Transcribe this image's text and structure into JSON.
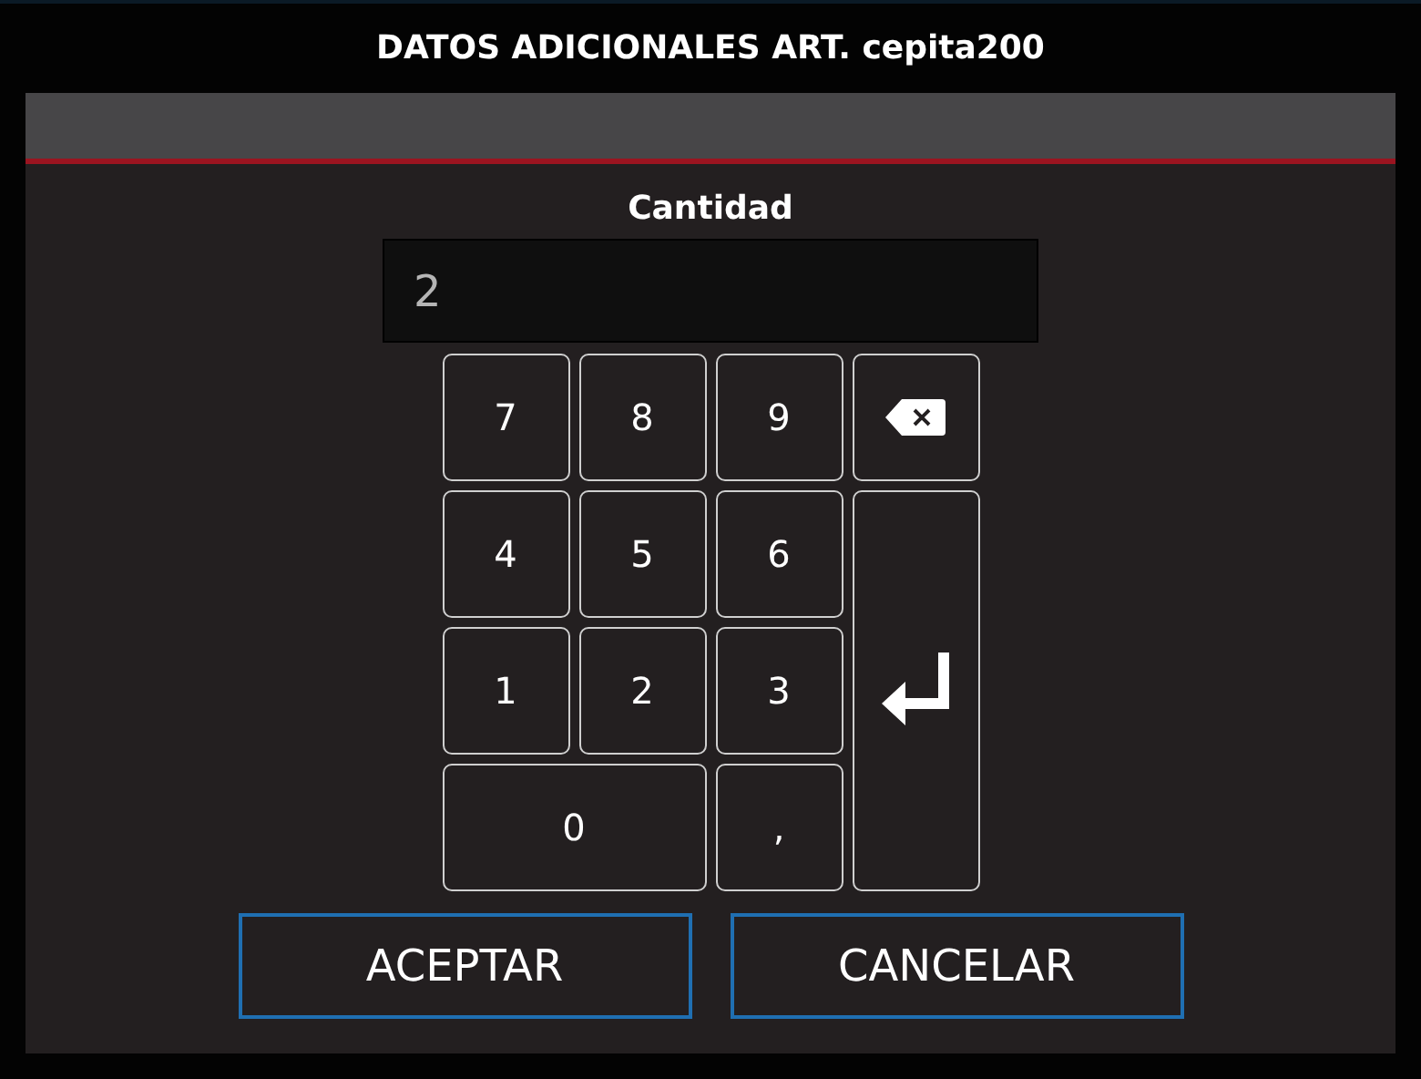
{
  "window": {
    "title": "DATOS ADICIONALES ART. cepita200"
  },
  "field": {
    "label": "Cantidad",
    "value": "2"
  },
  "keys": [
    {
      "kind": "digit",
      "label": "7"
    },
    {
      "kind": "digit",
      "label": "8"
    },
    {
      "kind": "digit",
      "label": "9"
    },
    {
      "kind": "backspace"
    },
    {
      "kind": "digit",
      "label": "4"
    },
    {
      "kind": "digit",
      "label": "5"
    },
    {
      "kind": "digit",
      "label": "6"
    },
    {
      "kind": "enter"
    },
    {
      "kind": "digit",
      "label": "1"
    },
    {
      "kind": "digit",
      "label": "2"
    },
    {
      "kind": "digit",
      "label": "3"
    },
    {
      "kind": "wide",
      "label": "0"
    },
    {
      "kind": "digit",
      "label": ","
    }
  ],
  "buttons": [
    "ACEPTAR",
    "CANCELAR"
  ]
}
